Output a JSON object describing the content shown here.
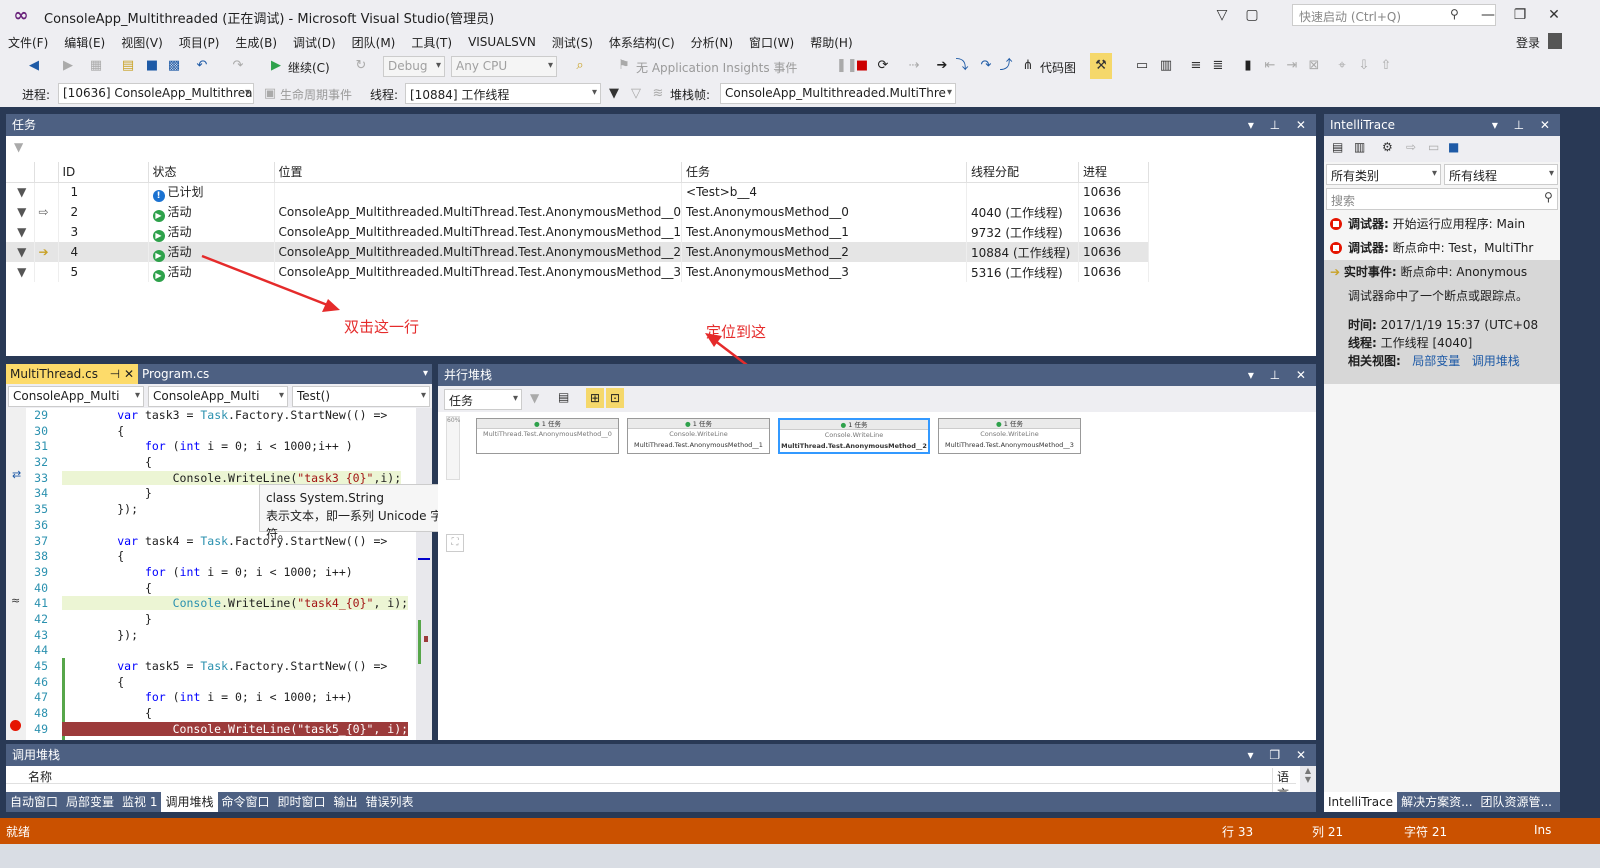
{
  "window": {
    "title": "ConsoleApp_Multithreaded (正在调试) - Microsoft Visual Studio(管理员)",
    "quick_launch_placeholder": "快速启动 (Ctrl+Q)",
    "login": "登录"
  },
  "menu": [
    "文件(F)",
    "编辑(E)",
    "视图(V)",
    "项目(P)",
    "生成(B)",
    "调试(D)",
    "团队(M)",
    "工具(T)",
    "VISUALSVN",
    "测试(S)",
    "体系结构(C)",
    "分析(N)",
    "窗口(W)",
    "帮助(H)"
  ],
  "toolbar1": {
    "continue_label": "继续(C)",
    "config": "Debug",
    "platform": "Any CPU",
    "app_insights": "无 Application Insights 事件",
    "code_map": "代码图"
  },
  "toolbar2": {
    "process_label": "进程:",
    "process_value": "[10636] ConsoleApp_Multithrea",
    "lifecycle": "生命周期事件",
    "thread_label": "线程:",
    "thread_value": "[10884] 工作线程",
    "stackframe_label": "堆栈帧:",
    "stackframe_value": "ConsoleApp_Multithreaded.MultiThre"
  },
  "tasks_panel": {
    "title": "任务",
    "columns": [
      "ID",
      "状态",
      "位置",
      "任务",
      "线程分配",
      "进程"
    ],
    "rows": [
      {
        "id": "1",
        "status": "已计划",
        "location": "",
        "task": "<Test>b__4",
        "thread": "",
        "process": "10636"
      },
      {
        "id": "2",
        "status": "活动",
        "location": "ConsoleApp_Multithreaded.MultiThread.Test.AnonymousMethod__0",
        "task": "Test.AnonymousMethod__0",
        "thread": "4040 (工作线程)",
        "process": "10636"
      },
      {
        "id": "3",
        "status": "活动",
        "location": "ConsoleApp_Multithreaded.MultiThread.Test.AnonymousMethod__1",
        "task": "Test.AnonymousMethod__1",
        "thread": "9732 (工作线程)",
        "process": "10636"
      },
      {
        "id": "4",
        "status": "活动",
        "location": "ConsoleApp_Multithreaded.MultiThread.Test.AnonymousMethod__2",
        "task": "Test.AnonymousMethod__2",
        "thread": "10884 (工作线程)",
        "process": "10636"
      },
      {
        "id": "5",
        "status": "活动",
        "location": "ConsoleApp_Multithreaded.MultiThread.Test.AnonymousMethod__3",
        "task": "Test.AnonymousMethod__3",
        "thread": "5316 (工作线程)",
        "process": "10636"
      }
    ]
  },
  "annotations": {
    "double_click": "双击这一行",
    "locate": "定位到这"
  },
  "editor": {
    "tabs": [
      "MultiThread.cs",
      "Program.cs"
    ],
    "nav_project": "ConsoleApp_Multi",
    "nav_class": "ConsoleApp_Multi",
    "nav_member": "Test()",
    "lines": [
      {
        "n": "29",
        "parts": [
          [
            "",
            "        "
          ],
          [
            "kw",
            "var"
          ],
          [
            "",
            " task3 = "
          ],
          [
            "ty",
            "Task"
          ],
          [
            "",
            ".Factory.StartNew(() =>"
          ]
        ]
      },
      {
        "n": "30",
        "parts": [
          [
            "",
            "        {"
          ]
        ]
      },
      {
        "n": "31",
        "parts": [
          [
            "",
            "            "
          ],
          [
            "kw",
            "for"
          ],
          [
            "",
            " ("
          ],
          [
            "kw",
            "int"
          ],
          [
            "",
            " i = 0; i < 1000;i++ )"
          ]
        ]
      },
      {
        "n": "32",
        "parts": [
          [
            "",
            "            {"
          ]
        ]
      },
      {
        "n": "33",
        "parts": [
          [
            "",
            "                Console.WriteLine("
          ],
          [
            "st",
            "\"task3_{0}\""
          ],
          [
            "",
            ",i);"
          ]
        ]
      },
      {
        "n": "34",
        "parts": [
          [
            "",
            "            }"
          ]
        ]
      },
      {
        "n": "35",
        "parts": [
          [
            "",
            "        });"
          ]
        ]
      },
      {
        "n": "36",
        "parts": [
          [
            "",
            ""
          ]
        ]
      },
      {
        "n": "37",
        "parts": [
          [
            "",
            "        "
          ],
          [
            "kw",
            "var"
          ],
          [
            "",
            " task4 = "
          ],
          [
            "ty",
            "Task"
          ],
          [
            "",
            ".Factory.StartNew(() =>"
          ]
        ]
      },
      {
        "n": "38",
        "parts": [
          [
            "",
            "        {"
          ]
        ]
      },
      {
        "n": "39",
        "parts": [
          [
            "",
            "            "
          ],
          [
            "kw",
            "for"
          ],
          [
            "",
            " ("
          ],
          [
            "kw",
            "int"
          ],
          [
            "",
            " i = 0; i < 1000; i++)"
          ]
        ]
      },
      {
        "n": "40",
        "parts": [
          [
            "",
            "            {"
          ]
        ]
      },
      {
        "n": "41",
        "parts": [
          [
            "",
            "                "
          ],
          [
            "ty",
            "Console"
          ],
          [
            "",
            ".WriteLine("
          ],
          [
            "st",
            "\"task4_{0}\""
          ],
          [
            "",
            ", i);"
          ]
        ]
      },
      {
        "n": "42",
        "parts": [
          [
            "",
            "            }"
          ]
        ]
      },
      {
        "n": "43",
        "parts": [
          [
            "",
            "        });"
          ]
        ]
      },
      {
        "n": "44",
        "parts": [
          [
            "",
            ""
          ]
        ]
      },
      {
        "n": "45",
        "parts": [
          [
            "",
            "        "
          ],
          [
            "kw",
            "var"
          ],
          [
            "",
            " task5 = "
          ],
          [
            "ty",
            "Task"
          ],
          [
            "",
            ".Factory.StartNew(() =>"
          ]
        ]
      },
      {
        "n": "46",
        "parts": [
          [
            "",
            "        {"
          ]
        ]
      },
      {
        "n": "47",
        "parts": [
          [
            "",
            "            "
          ],
          [
            "kw",
            "for"
          ],
          [
            "",
            " ("
          ],
          [
            "kw",
            "int"
          ],
          [
            "",
            " i = 0; i < 1000; i++)"
          ]
        ]
      },
      {
        "n": "48",
        "parts": [
          [
            "",
            "            {"
          ]
        ]
      },
      {
        "n": "49",
        "parts": [
          [
            "",
            "                Console.WriteLine(\"task5_{0}\", i);"
          ]
        ]
      }
    ],
    "tooltip_line1": "class System.String",
    "tooltip_line2": "表示文本，即一系列 Unicode 字符。"
  },
  "parallel_stacks": {
    "title": "并行堆栈",
    "view_select": "任务",
    "zoom": "60%",
    "boxes": [
      {
        "header": "1 任务",
        "line1": "MultiThread.Test.AnonymousMethod__0",
        "line2": ""
      },
      {
        "header": "1 任务",
        "line1": "Console.WriteLine",
        "line2": "MultiThread.Test.AnonymousMethod__1"
      },
      {
        "header": "1 任务",
        "line1": "Console.WriteLine",
        "line2": "MultiThread.Test.AnonymousMethod__2"
      },
      {
        "header": "1 任务",
        "line1": "Console.WriteLine",
        "line2": "MultiThread.Test.AnonymousMethod__3"
      }
    ]
  },
  "intellitrace": {
    "title": "IntelliTrace",
    "filter_category": "所有类别",
    "filter_thread": "所有线程",
    "search_placeholder": "搜索",
    "events": [
      {
        "kind": "调试器:",
        "text": "开始运行应用程序: Main"
      },
      {
        "kind": "调试器:",
        "text": "断点命中: Test，MultiThr"
      }
    ],
    "live_kind": "实时事件:",
    "live_text": "断点命中: Anonymous",
    "live_desc": "调试器命中了一个断点或跟踪点。",
    "time_label": "时间:",
    "time_value": "2017/1/19 15:37 (UTC+08",
    "thread_label": "线程:",
    "thread_value": "工作线程 [4040]",
    "related_label": "相关视图:",
    "related_locals": "局部变量",
    "related_callstack": "调用堆栈",
    "bottom_tabs": [
      "IntelliTrace",
      "解决方案资...",
      "团队资源管..."
    ]
  },
  "callstack": {
    "title": "调用堆栈",
    "col_name": "名称",
    "col_lang": "语言"
  },
  "bottom_tabs": [
    "自动窗口",
    "局部变量",
    "监视 1",
    "调用堆栈",
    "命令窗口",
    "即时窗口",
    "输出",
    "错误列表"
  ],
  "statusbar": {
    "ready": "就绪",
    "line": "行 33",
    "col": "列 21",
    "char": "字符 21",
    "ins": "Ins"
  },
  "colors": {
    "status_bar": "#ca5100",
    "panel_header": "#4d6082",
    "active_header": "#007acc",
    "annotation": "#e52b2b"
  }
}
